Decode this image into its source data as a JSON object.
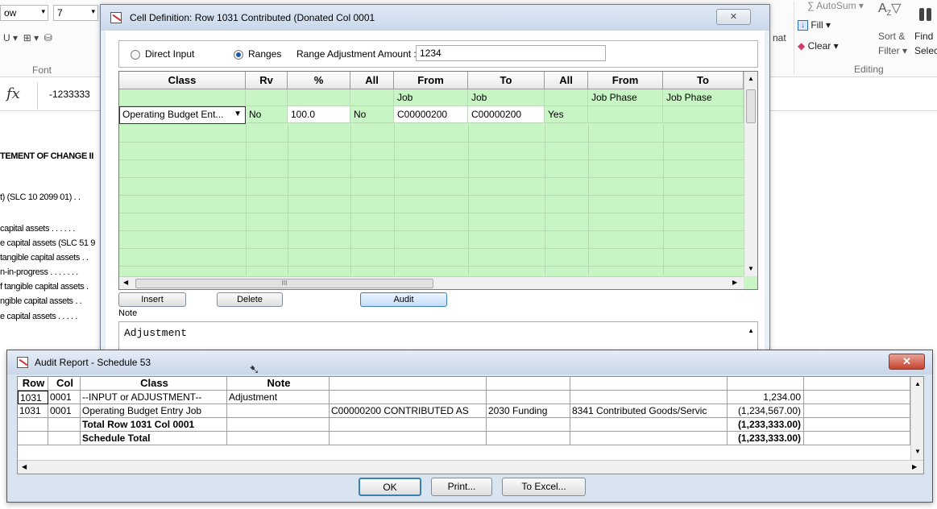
{
  "excel": {
    "font_combo": "ow",
    "size_combo": "7",
    "font_group_label": "Font",
    "fx_label": "fx",
    "formula_value": "-1233333",
    "format_partial": "nat",
    "autosum": "AutoSum",
    "fill": "Fill",
    "clear": "Clear",
    "sort_filter_1": "Sort &",
    "sort_filter_2": "Filter",
    "find_1": "Find",
    "find_2": "Selec",
    "editing_label": "Editing",
    "sheet_lines": [
      "TEMENT OF CHANGE II",
      "t) (SLC 10 2099 01) . .",
      "capital assets . . . . . .",
      "e capital assets (SLC 51 9",
      "tangible capital assets . .",
      "n-in-progress . . . . . . .",
      "f tangible capital assets .",
      "ngible capital assets . .",
      "e capital assets . . . . ."
    ]
  },
  "cell_def": {
    "title": "Cell Definition: Row 1031 Contributed (Donated Col 0001",
    "radio_direct": "Direct Input",
    "radio_ranges": "Ranges",
    "range_adj_label": "Range Adjustment Amount :",
    "range_adj_value": "1234",
    "headers": [
      "Class",
      "Rv",
      "%",
      "All",
      "From",
      "To",
      "All",
      "From",
      "To"
    ],
    "subheaders": [
      "",
      "",
      "",
      "",
      "Job",
      "Job",
      "",
      "Job Phase",
      "Job Phase"
    ],
    "row1": [
      "Operating Budget Ent...",
      "No",
      "100.0",
      "No",
      "C00000200",
      "C00000200",
      "Yes",
      "",
      ""
    ],
    "scroll_mid": "III",
    "btn_insert": "Insert",
    "btn_delete": "Delete",
    "btn_audit": "Audit",
    "note_label": "Note",
    "note_value": "Adjustment"
  },
  "audit": {
    "title": "Audit Report - Schedule 53",
    "headers": [
      "Row",
      "Col",
      "Class",
      "Note",
      "",
      "",
      "",
      "",
      ""
    ],
    "rows": [
      [
        "1031",
        "0001",
        "--INPUT or ADJUSTMENT--",
        "Adjustment",
        "",
        "",
        "",
        "1,234.00",
        ""
      ],
      [
        "1031",
        "0001",
        "Operating Budget Entry Job",
        "",
        "C00000200 CONTRIBUTED AS",
        "2030 Funding",
        "8341 Contributed Goods/Servic",
        "(1,234,567.00)",
        ""
      ],
      [
        "",
        "",
        "Total Row 1031 Col 0001",
        "",
        "",
        "",
        "",
        "(1,233,333.00)",
        ""
      ],
      [
        "",
        "",
        "Schedule Total",
        "",
        "",
        "",
        "",
        "(1,233,333.00)",
        ""
      ]
    ],
    "btn_ok": "OK",
    "btn_print": "Print...",
    "btn_excel": "To Excel..."
  }
}
